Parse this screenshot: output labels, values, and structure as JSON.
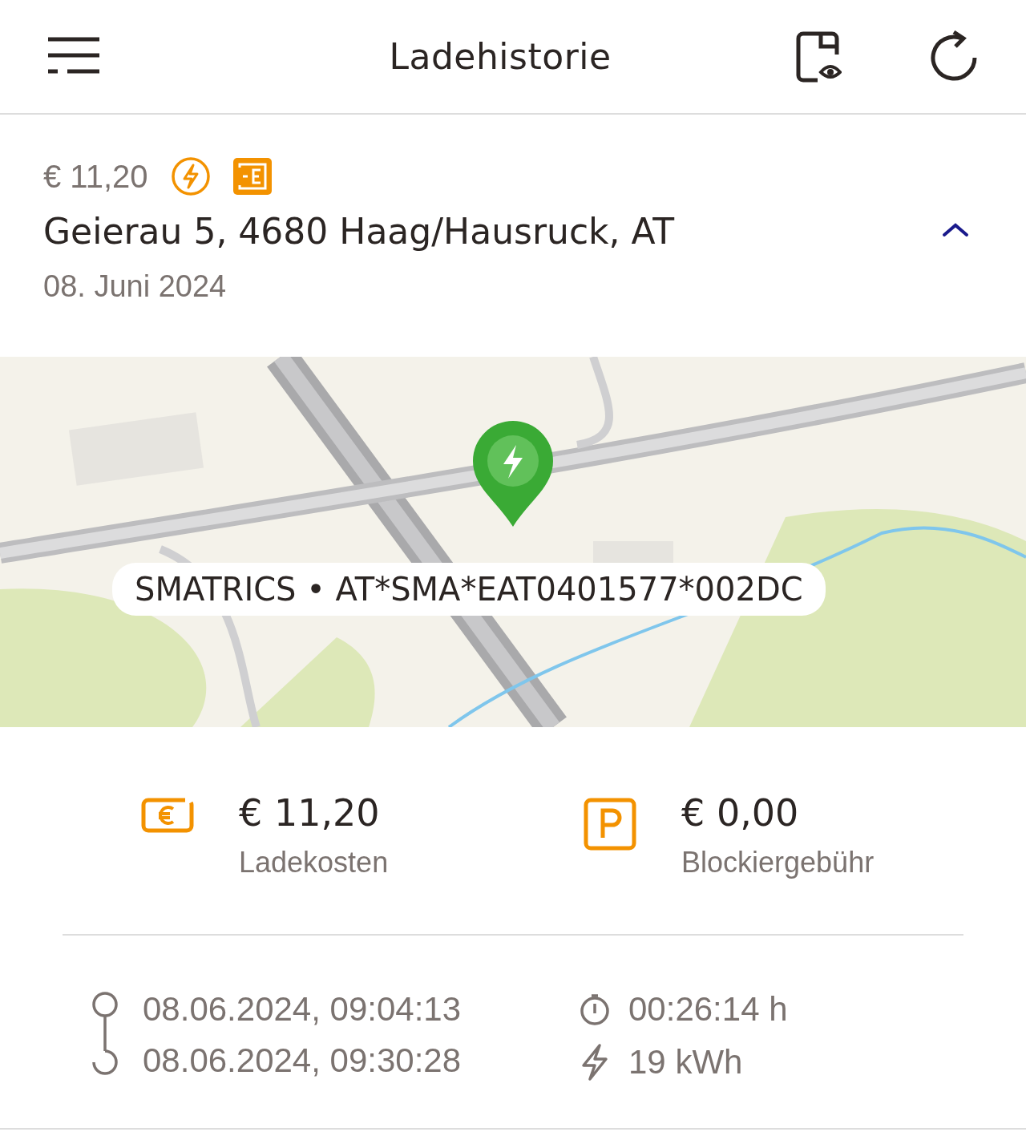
{
  "header": {
    "title": "Ladehistorie"
  },
  "summary": {
    "price": "€ 11,20",
    "address": "Geierau 5, 4680 Haag/Hausruck, AT",
    "date": "08. Juni 2024",
    "expanded": true
  },
  "map": {
    "kind": "picture",
    "station_label": "SMATRICS • AT*SMA*EAT0401577*002DC"
  },
  "costs": [
    {
      "kind": "charging",
      "amount": "€ 11,20",
      "label": "Ladekosten"
    },
    {
      "kind": "parking",
      "amount": "€ 0,00",
      "label": "Blockiergebühr"
    }
  ],
  "session": {
    "start": "08.06.2024, 09:04:13",
    "end": "08.06.2024, 09:30:28",
    "duration": "00:26:14 h",
    "energy": "19 kWh"
  }
}
